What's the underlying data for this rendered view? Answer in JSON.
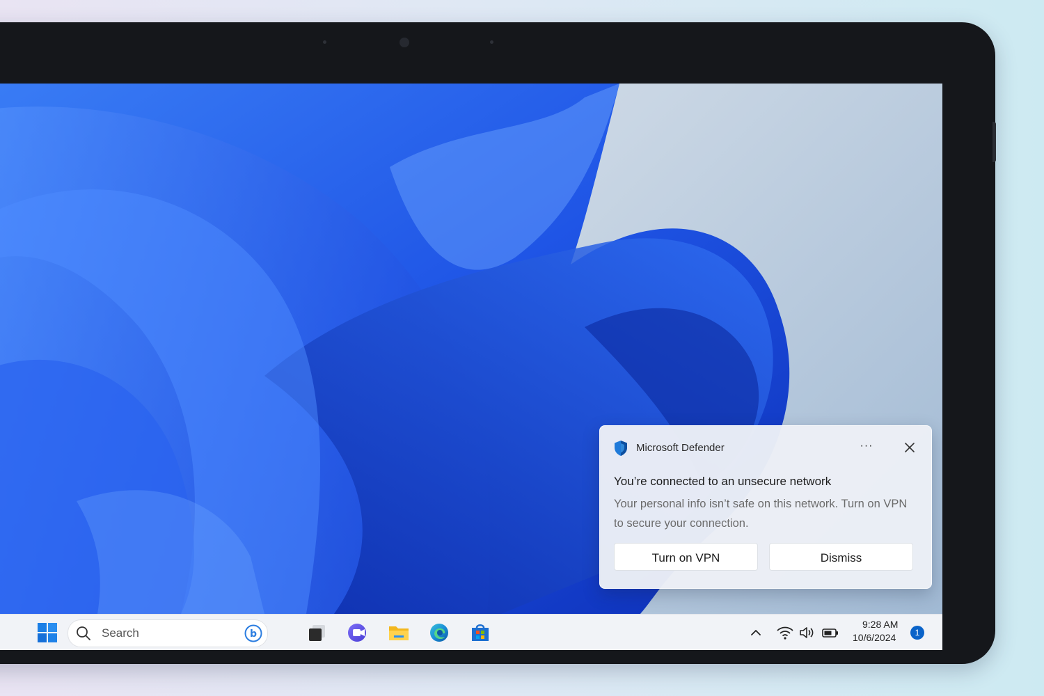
{
  "toast": {
    "app_name": "Microsoft Defender",
    "more_label": "···",
    "title": "You’re connected to an unsecure network",
    "body": "Your personal info isn’t safe on this network. Turn on VPN to secure your connection.",
    "primary_button": "Turn on VPN",
    "secondary_button": "Dismiss"
  },
  "taskbar": {
    "search_placeholder": "Search",
    "pinned": [
      "start-icon",
      "bing-chat-icon",
      "task-view-icon",
      "clipchamp-icon",
      "file-explorer-icon",
      "edge-icon",
      "store-icon"
    ],
    "tray_icons": [
      "chevron-up-icon",
      "wifi-icon",
      "volume-icon",
      "battery-icon"
    ],
    "time": "9:28 AM",
    "date": "10/6/2024",
    "notification_count": "1"
  },
  "colors": {
    "accent": "#0a63c9",
    "wallpaper_blue": "#1747e0",
    "taskbar_bg": "#f1f3f7"
  }
}
